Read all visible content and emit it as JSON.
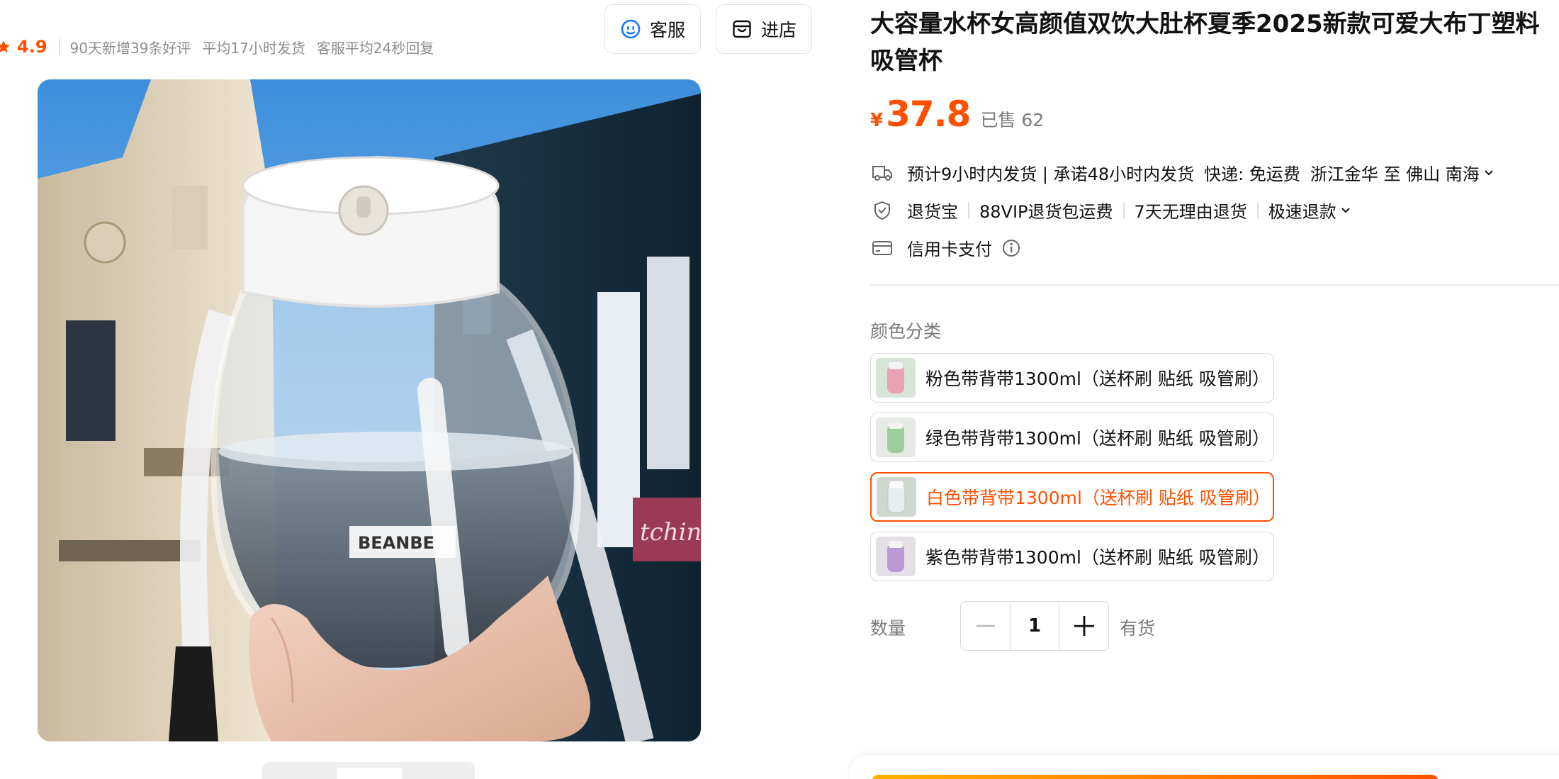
{
  "store": {
    "rating": "4.9",
    "stats": [
      "90天新增39条好评",
      "平均17小时发货",
      "客服平均24秒回复"
    ],
    "buttons": {
      "service": "客服",
      "shop": "进店"
    }
  },
  "product": {
    "title": "大容量水杯女高颜值双饮大肚杯夏季2025新款可爱大布丁塑料吸管杯",
    "currency": "¥",
    "price": "37.8",
    "sold": "已售 62"
  },
  "image": {
    "cup_brand_text": "BEANBE",
    "bg_text": "tchinT"
  },
  "services": {
    "shipping": {
      "estimate": "预计9小时内发货 | 承诺48小时内发货",
      "express": "快递: 免运费",
      "route": "浙江金华 至 佛山 南海"
    },
    "returns": [
      "退货宝",
      "88VIP退货包运费",
      "7天无理由退货",
      "极速退款"
    ],
    "payment": "信用卡支付"
  },
  "sku": {
    "label": "颜色分类",
    "options": [
      {
        "label": "粉色带背带1300ml（送杯刷 贴纸 吸管刷）",
        "swatch": "#e9a2b5",
        "selected": false
      },
      {
        "label": "绿色带背带1300ml（送杯刷 贴纸 吸管刷）",
        "swatch": "#9ecc9c",
        "selected": false
      },
      {
        "label": "白色带背带1300ml（送杯刷 贴纸 吸管刷）",
        "swatch": "#e8ecef",
        "selected": true
      },
      {
        "label": "紫色带背带1300ml（送杯刷 贴纸 吸管刷）",
        "swatch": "#b79ad6",
        "selected": false
      }
    ]
  },
  "quantity": {
    "label": "数量",
    "value": "1",
    "stock": "有货"
  },
  "colors": {
    "accent": "#ff5000",
    "muted": "#8d8d8d",
    "border": "#d8d8d8"
  },
  "icons": [
    "star-icon",
    "service-face-icon",
    "shop-icon",
    "truck-icon",
    "return-shield-icon",
    "credit-card-icon",
    "info-icon",
    "chevron-down-icon",
    "minus-icon",
    "plus-icon"
  ]
}
